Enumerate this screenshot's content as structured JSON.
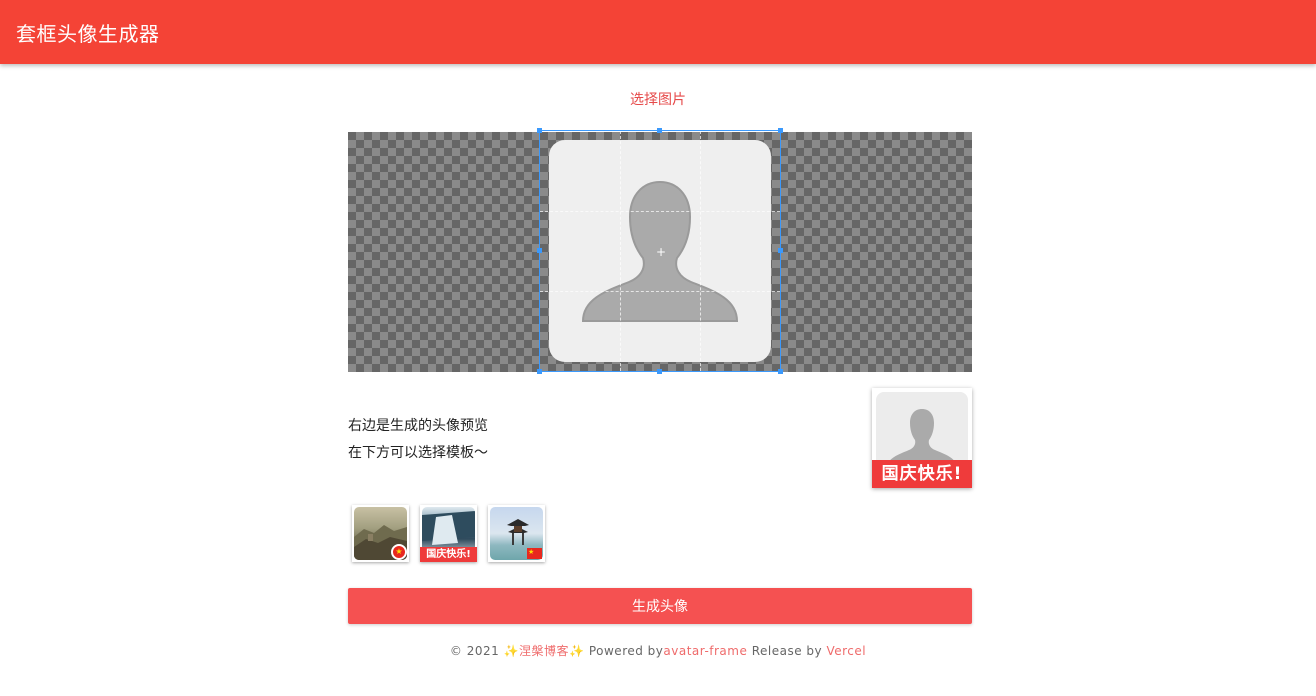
{
  "header": {
    "title": "套框头像生成器"
  },
  "select_image_label": "选择图片",
  "description": {
    "line1": "右边是生成的头像预览",
    "line2": "在下方可以选择模板～"
  },
  "preview": {
    "banner_text": "国庆快乐!"
  },
  "templates": [
    {
      "name": "great-wall",
      "badge": "china-flag-circle"
    },
    {
      "name": "waterfall",
      "banner_text": "国庆快乐!"
    },
    {
      "name": "pagoda",
      "badge": "china-flag-rect"
    }
  ],
  "generate_button_label": "生成头像",
  "footer": {
    "copyright": "© 2021",
    "blog_name": "涅槃博客",
    "powered_by": "Powered by",
    "project_link": "avatar-frame",
    "release_by": "Release by",
    "host_link": "Vercel"
  },
  "colors": {
    "primary": "#f44336",
    "button": "#f55151",
    "link": "#ef6b6b",
    "crop_border": "#3b99fc"
  }
}
